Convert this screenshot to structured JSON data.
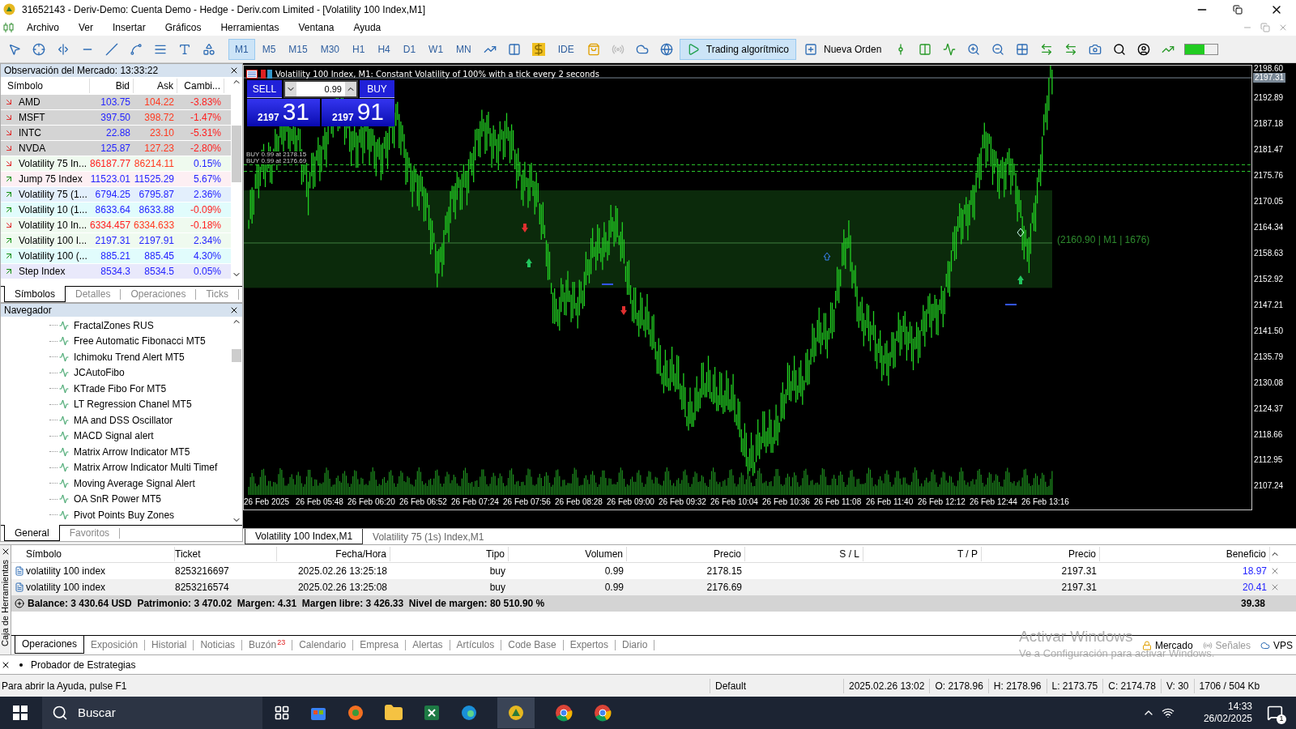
{
  "window": {
    "title": "31652143 - Deriv-Demo: Cuenta Demo - Hedge - Deriv.com Limited - [Volatility 100 Index,M1]"
  },
  "menu": [
    "Archivo",
    "Ver",
    "Insertar",
    "Gráficos",
    "Herramientas",
    "Ventana",
    "Ayuda"
  ],
  "toolbar": {
    "timeframes": [
      {
        "label": "M1",
        "selected": true
      },
      {
        "label": "M5",
        "selected": false
      },
      {
        "label": "M15",
        "selected": false
      },
      {
        "label": "M30",
        "selected": false
      },
      {
        "label": "H1",
        "selected": false
      },
      {
        "label": "H4",
        "selected": false
      },
      {
        "label": "D1",
        "selected": false
      },
      {
        "label": "W1",
        "selected": false
      },
      {
        "label": "MN",
        "selected": false
      }
    ],
    "ide": "IDE",
    "algo_trading": "Trading algorítmico",
    "new_order": "Nueva Orden"
  },
  "market_watch": {
    "title": "Observación del Mercado: 13:33:22",
    "columns": [
      "Símbolo",
      "Bid",
      "Ask",
      "Cambi..."
    ],
    "rows": [
      {
        "symbol": "AMD",
        "bid": "103.75",
        "ask": "104.22",
        "change": "-3.83%",
        "falling": true,
        "bid_down": false,
        "ask_down": true,
        "negative": true,
        "color": "#d4d4d4"
      },
      {
        "symbol": "MSFT",
        "bid": "397.50",
        "ask": "398.72",
        "change": "-1.47%",
        "falling": true,
        "bid_down": false,
        "ask_down": true,
        "negative": true,
        "color": "#d4d4d4"
      },
      {
        "symbol": "INTC",
        "bid": "22.88",
        "ask": "23.10",
        "change": "-5.31%",
        "falling": true,
        "bid_down": false,
        "ask_down": true,
        "negative": true,
        "color": "#d4d4d4"
      },
      {
        "symbol": "NVDA",
        "bid": "125.87",
        "ask": "127.23",
        "change": "-2.80%",
        "falling": true,
        "bid_down": false,
        "ask_down": true,
        "negative": true,
        "color": "#d4d4d4"
      },
      {
        "symbol": "Volatility 75 In...",
        "bid": "86187.77",
        "ask": "86214.11",
        "change": "0.15%",
        "falling": true,
        "bid_down": true,
        "ask_down": true,
        "negative": false,
        "color": "#effaef"
      },
      {
        "symbol": "Jump 75 Index",
        "bid": "11523.01",
        "ask": "11525.29",
        "change": "5.67%",
        "falling": false,
        "bid_down": false,
        "ask_down": false,
        "negative": false,
        "color": "#fdeff3"
      },
      {
        "symbol": "Volatility 75 (1...",
        "bid": "6794.25",
        "ask": "6795.87",
        "change": "2.36%",
        "falling": false,
        "bid_down": false,
        "ask_down": false,
        "negative": false,
        "color": "#e3effc"
      },
      {
        "symbol": "Volatility 10 (1...",
        "bid": "8633.64",
        "ask": "8633.88",
        "change": "-0.09%",
        "falling": false,
        "bid_down": false,
        "ask_down": false,
        "negative": true,
        "color": "#e1fcfc"
      },
      {
        "symbol": "Volatility 10 In...",
        "bid": "6334.457",
        "ask": "6334.633",
        "change": "-0.18%",
        "falling": true,
        "bid_down": true,
        "ask_down": true,
        "negative": true,
        "color": "#effaef"
      },
      {
        "symbol": "Volatility 100 I...",
        "bid": "2197.31",
        "ask": "2197.91",
        "change": "2.34%",
        "falling": false,
        "bid_down": false,
        "ask_down": false,
        "negative": false,
        "color": "#effaef"
      },
      {
        "symbol": "Volatility 100 (...",
        "bid": "885.21",
        "ask": "885.45",
        "change": "4.30%",
        "falling": false,
        "bid_down": false,
        "ask_down": false,
        "negative": false,
        "color": "#e1fcfc"
      },
      {
        "symbol": "Step Index",
        "bid": "8534.3",
        "ask": "8534.5",
        "change": "0.05%",
        "falling": false,
        "bid_down": false,
        "ask_down": false,
        "negative": false,
        "color": "#e9e9fb"
      }
    ],
    "tabs": [
      {
        "label": "Símbolos",
        "selected": true
      },
      {
        "label": "Detalles",
        "selected": false
      },
      {
        "label": "Operaciones",
        "selected": false
      },
      {
        "label": "Ticks",
        "selected": false
      }
    ]
  },
  "navigator": {
    "title": "Navegador",
    "items": [
      "FractalZones RUS",
      "Free Automatic Fibonacci MT5",
      "Ichimoku Trend Alert MT5",
      "JCAutoFibo",
      "KTrade Fibo For MT5",
      "LT Regression Chanel MT5",
      "MA and DSS Oscillator",
      "MACD Signal alert",
      "Matrix Arrow Indicator MT5",
      "Matrix Arrow Indicator Multi Timef",
      "Moving Average Signal Alert",
      "OA SnR Power MT5",
      "Pivot Points Buy Zones"
    ],
    "tabs": [
      {
        "label": "General",
        "selected": true
      },
      {
        "label": "Favoritos",
        "selected": false
      }
    ]
  },
  "chart": {
    "title": "Volatility 100 Index, M1:  Constant Volatility of 100% with a tick every 2 seconds",
    "trade_panel": {
      "sell": "SELL",
      "buy": "BUY",
      "volume": "0.99",
      "sell_big": "2197",
      "sell_small": "31",
      "buy_big": "2197",
      "buy_small": "91"
    },
    "order_labels": [
      "BUY 0.99 at 2178.15",
      "BUY 0.99 at 2176.69"
    ],
    "annotation": "(2160.90 | M1 | 1676)",
    "current_price": "2197.31",
    "price_ticks": [
      "2198.60",
      "2192.89",
      "2187.18",
      "2181.47",
      "2175.76",
      "2170.05",
      "2164.34",
      "2158.63",
      "2152.92",
      "2147.21",
      "2141.50",
      "2135.79",
      "2130.08",
      "2124.37",
      "2118.66",
      "2112.95",
      "2107.24"
    ],
    "time_labels": [
      "26 Feb 2025",
      "26 Feb 05:48",
      "26 Feb 06:20",
      "26 Feb 06:52",
      "26 Feb 07:24",
      "26 Feb 07:56",
      "26 Feb 08:28",
      "26 Feb 09:00",
      "26 Feb 09:32",
      "26 Feb 10:04",
      "26 Feb 10:36",
      "26 Feb 11:08",
      "26 Feb 11:40",
      "26 Feb 12:12",
      "26 Feb 12:44",
      "26 Feb 13:16"
    ],
    "tabs": [
      {
        "label": "Volatility 100 Index,M1",
        "selected": true
      },
      {
        "label": "Volatility 75 (1s) Index,M1",
        "selected": false
      }
    ]
  },
  "terminal": {
    "side_label": "Caja de Herramientas",
    "columns": [
      "Símbolo",
      "Ticket",
      "Fecha/Hora",
      "Tipo",
      "Volumen",
      "Precio",
      "S / L",
      "T / P",
      "Precio",
      "Beneficio"
    ],
    "rows": [
      {
        "symbol": "volatility 100 index",
        "ticket": "8253216697",
        "time": "2025.02.26 13:25:18",
        "type": "buy",
        "volume": "0.99",
        "price": "2178.15",
        "current": "2197.31",
        "profit": "18.97"
      },
      {
        "symbol": "volatility 100 index",
        "ticket": "8253216574",
        "time": "2025.02.26 13:25:08",
        "type": "buy",
        "volume": "0.99",
        "price": "2176.69",
        "current": "2197.31",
        "profit": "20.41"
      }
    ],
    "balance": "Balance: 3 430.64 USD  Patrimonio: 3 470.02  Margen: 4.31  Margen libre: 3 426.33  Nivel de margen: 80 510.90 %",
    "total": "39.38",
    "tabs": [
      {
        "label": "Operaciones",
        "selected": true
      },
      {
        "label": "Exposición",
        "selected": false
      },
      {
        "label": "Historial",
        "selected": false
      },
      {
        "label": "Noticias",
        "selected": false
      },
      {
        "label": "Buzón",
        "selected": false,
        "badge": "23"
      },
      {
        "label": "Calendario",
        "selected": false
      },
      {
        "label": "Empresa",
        "selected": false
      },
      {
        "label": "Alertas",
        "selected": false
      },
      {
        "label": "Artículos",
        "selected": false
      },
      {
        "label": "Code Base",
        "selected": false
      },
      {
        "label": "Expertos",
        "selected": false
      },
      {
        "label": "Diario",
        "selected": false
      }
    ],
    "right_links": [
      {
        "kind": "market",
        "label": "Mercado"
      },
      {
        "kind": "signals",
        "label": "Señales"
      },
      {
        "kind": "vps",
        "label": "VPS"
      }
    ]
  },
  "tester": {
    "label": "Probador de Estrategias"
  },
  "activation": {
    "title": "Activar Windows",
    "subtitle": "Ve a Configuración para activar Windows."
  },
  "status_bar": [
    "Para abrir la Ayuda, pulse F1",
    "Default",
    "2025.02.26 13:02",
    "O: 2178.96",
    "H: 2178.96",
    "L: 2173.75",
    "C: 2174.78",
    "V: 30",
    "1706 / 504 Kb"
  ],
  "taskbar": {
    "search": "Buscar",
    "time": "14:33",
    "date": "26/02/2025",
    "notifications": "1"
  }
}
